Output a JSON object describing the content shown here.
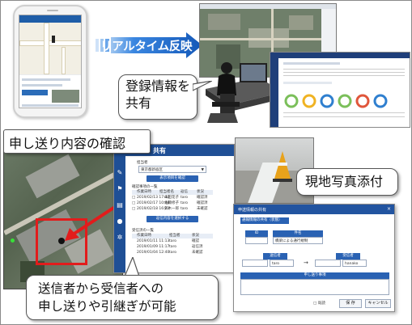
{
  "banner": {
    "realtime_label": "リアルタイム反映"
  },
  "callouts": {
    "share": "登録情報を\n共有",
    "check": "申し送り内容の確認",
    "photo": "現地写真添付",
    "bottom": "送信者から受信者への\n申し送りや引継ぎが可能"
  },
  "mid_app": {
    "header": "共有",
    "sender_label": "担当者",
    "sender_value": "東京都新宿区",
    "search_button": "表示項目を確認",
    "list1_title": "確認事項の一覧",
    "list1_headers": [
      "作業日時",
      "担当者名",
      "返信",
      "状況"
    ],
    "list1_rows": [
      [
        "2019/02/13 17:03",
        "山田花子",
        "taro",
        "確認済"
      ],
      [
        "2019/02/17 10:48",
        "佐藤修子",
        "taro",
        "確認済"
      ],
      [
        "2019/02/18 16:23",
        "鈴木一郎",
        "taro",
        "未確認"
      ]
    ],
    "select_button": "返信内容を選択する",
    "list2_title": "受信済の一覧",
    "list2_headers": [
      "作業日時",
      "担当者",
      "状況"
    ],
    "list2_rows": [
      [
        "2019/01/11 11:13",
        "taro",
        "確認"
      ],
      [
        "2019/01/09 11:17",
        "taro",
        "返信済"
      ],
      [
        "2019/01/04 12:40",
        "taro",
        "未確認"
      ]
    ]
  },
  "dialog": {
    "title": "申送情報の共有",
    "close": "×",
    "section": "通報情報の共有（状態）",
    "id_label": "ID",
    "subject_label": "件名",
    "subject_value": "橋梁による通行規制",
    "sender_label": "送信者",
    "sender_value": "taro",
    "receiver_label": "受信者",
    "receiver_value": "hanako",
    "arrow": "→",
    "message_label": "申し送り事項",
    "check_label": "既読",
    "save_button": "保 存",
    "cancel_button": "キャンセル"
  },
  "colors": {
    "accent_blue": "#1e6fd6",
    "red_box": "#e21c1c",
    "app_navy": "#1f4f95"
  }
}
